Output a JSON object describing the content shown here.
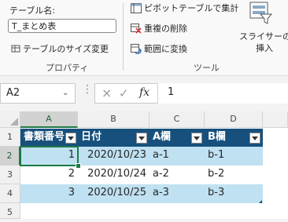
{
  "ribbon": {
    "table_name_label": "テーブル名:",
    "table_name_value": "T_まとめ表",
    "resize_table": "テーブルのサイズ変更",
    "properties_group": "プロパティ",
    "pivot_summary": "ピボットテーブルで集計",
    "remove_duplicates": "重複の削除",
    "convert_to_range": "範囲に変換",
    "tools_group": "ツール",
    "slicer_line1": "スライサーの",
    "slicer_line2": "挿入"
  },
  "formula_bar": {
    "name_box": "A2",
    "cancel_icon": "×",
    "enter_icon": "✓",
    "fx": "fx",
    "value": "1"
  },
  "grid": {
    "columns": [
      "A",
      "B",
      "C",
      "D"
    ],
    "rows": [
      "1",
      "2",
      "3",
      "4",
      "5"
    ],
    "headers": [
      "書類番号",
      "日付",
      "A欄",
      "B欄"
    ],
    "data": [
      [
        "1",
        "2020/10/23",
        "a-1",
        "b-1"
      ],
      [
        "2",
        "2020/10/24",
        "a-2",
        "b-2"
      ],
      [
        "3",
        "2020/10/25",
        "a-3",
        "b-3"
      ]
    ]
  },
  "colors": {
    "header_fill": "#17507c",
    "band_fill": "#bfe1f2",
    "selection": "#1d7a45"
  }
}
